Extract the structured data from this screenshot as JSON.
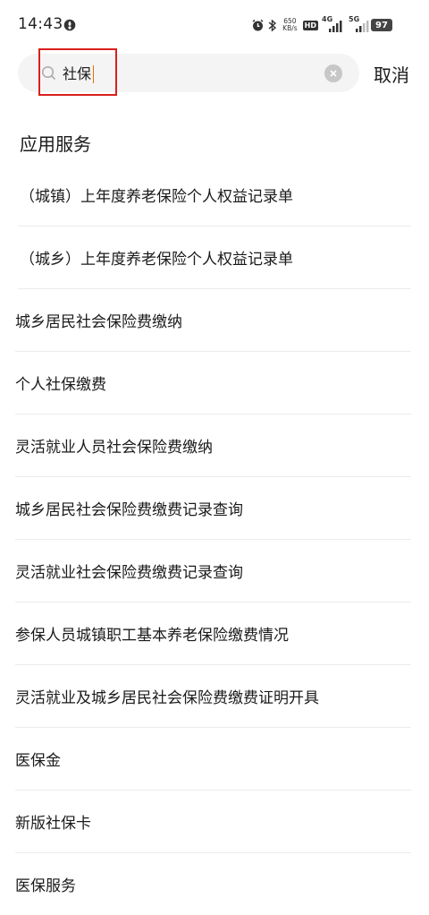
{
  "status_bar": {
    "time": "14:43",
    "net_speed_value": "650",
    "net_speed_unit": "KB/s",
    "hd_label": "HD",
    "sim1_label": "4G",
    "sim2_label": "5G",
    "battery_level": "97"
  },
  "search": {
    "value": "社保",
    "cancel_label": "取消"
  },
  "section": {
    "title": "应用服务"
  },
  "results": [
    {
      "label": "（城镇）上年度养老保险个人权益记录单"
    },
    {
      "label": "（城乡）上年度养老保险个人权益记录单"
    },
    {
      "label": "城乡居民社会保险费缴纳"
    },
    {
      "label": "个人社保缴费"
    },
    {
      "label": "灵活就业人员社会保险费缴纳"
    },
    {
      "label": "城乡居民社会保险费缴费记录查询"
    },
    {
      "label": "灵活就业社会保险费缴费记录查询"
    },
    {
      "label": "参保人员城镇职工基本养老保险缴费情况"
    },
    {
      "label": "灵活就业及城乡居民社会保险费缴费证明开具"
    },
    {
      "label": "医保金"
    },
    {
      "label": "新版社保卡"
    },
    {
      "label": "医保服务"
    }
  ],
  "colors": {
    "highlight": "#d9201c",
    "cursor": "#e86f00",
    "search_bg": "#f4f4f4"
  }
}
